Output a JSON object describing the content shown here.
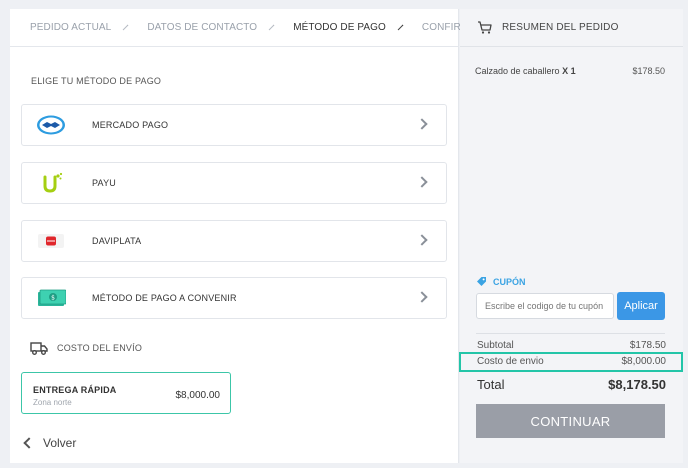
{
  "breadcrumb": [
    {
      "label": "PEDIDO ACTUAL"
    },
    {
      "label": "DATOS DE CONTACTO"
    },
    {
      "label": "MÉTODO DE PAGO"
    },
    {
      "label": "CONFIRMACIÓN"
    }
  ],
  "payment": {
    "title": "ELIGE TU MÉTODO DE PAGO",
    "methods": [
      {
        "label": "MERCADO PAGO",
        "icon": "mercadopago-logo-icon"
      },
      {
        "label": "PAYU",
        "icon": "payu-logo-icon"
      },
      {
        "label": "DAVIPLATA",
        "icon": "daviplata-logo-icon"
      },
      {
        "label": "MÉTODO DE PAGO A CONVENIR",
        "icon": "cash-icon"
      }
    ]
  },
  "shipping": {
    "title": "COSTO DEL ENVÍO",
    "option_name": "ENTREGA RÁPIDA",
    "option_zone": "Zona norte",
    "option_price": "$8,000.00"
  },
  "back_label": "Volver",
  "summary": {
    "title": "RESUMEN DEL PEDIDO",
    "item_name": "Calzado de caballero",
    "item_qty": "X 1",
    "item_price": "$178.50",
    "coupon_label": "CUPÓN",
    "coupon_placeholder": "Escribe el codigo de tu cupón",
    "apply_label": "Aplicar",
    "subtotal_label": "Subtotal",
    "subtotal_value": "$178.50",
    "shipping_label": "Costo de envio",
    "shipping_value": "$8,000.00",
    "total_label": "Total",
    "total_value": "$8,178.50",
    "continue_label": "CONTINUAR"
  },
  "colors": {
    "accent_green": "#23c5a8",
    "button_blue": "#3b97e6",
    "coupon_blue": "#3aa3e3",
    "continue_gray": "#9a9ea7"
  }
}
